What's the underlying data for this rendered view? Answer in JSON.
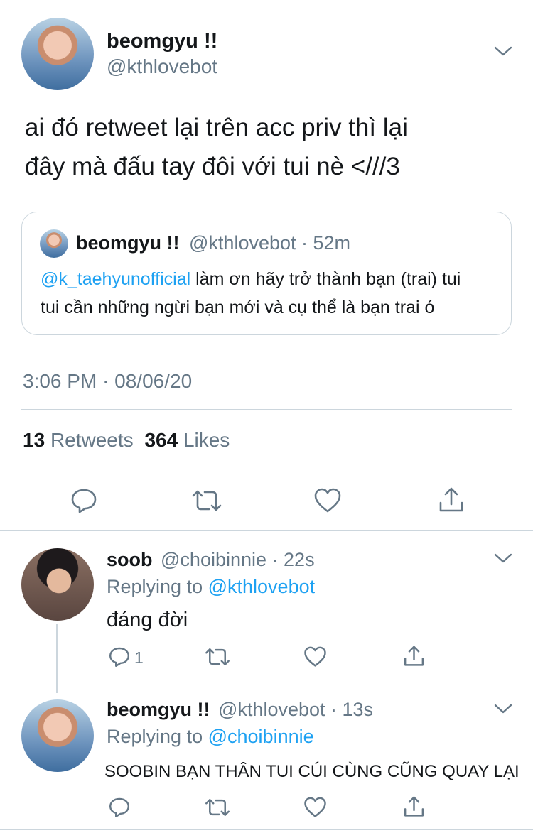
{
  "main_tweet": {
    "display_name": "beomgyu !!",
    "handle": "@kthlovebot",
    "text_line1": "ai đó retweet lại trên acc priv thì lại",
    "text_line2": "đây mà đấu tay đôi với tui nè <///3",
    "timestamp": "3:06 PM · 08/06/20",
    "retweet_count": "13",
    "retweet_label": "Retweets",
    "like_count": "364",
    "like_label": "Likes"
  },
  "quoted_tweet": {
    "display_name": "beomgyu !!",
    "handle": "@kthlovebot",
    "time": "· 52m",
    "mention": "@k_taehyunofficial",
    "text_line1_rest": " làm ơn hãy trở thành bạn (trai) tui",
    "text_line2": "tui cần những ngừi bạn mới và cụ thể là bạn trai ó"
  },
  "replies": [
    {
      "display_name": "soob",
      "handle": "@choibinnie",
      "time": "· 22s",
      "replying_prefix": "Replying to",
      "replying_to": "@kthlovebot",
      "text": "đáng đời",
      "reply_count": "1"
    },
    {
      "display_name": "beomgyu !!",
      "handle": "@kthlovebot",
      "time": "· 13s",
      "replying_prefix": "Replying to",
      "replying_to": "@choibinnie",
      "text": "SOOBIN BẠN THÂN TUI CÚI CÙNG CŨNG QUAY LẠI",
      "reply_count": ""
    }
  ],
  "colors": {
    "link": "#1da1f2",
    "muted": "#657786",
    "divider": "#ccd6dd",
    "icon": "#657786"
  },
  "icons": [
    "chevron-down-icon",
    "reply-icon",
    "retweet-icon",
    "like-icon",
    "share-icon"
  ]
}
